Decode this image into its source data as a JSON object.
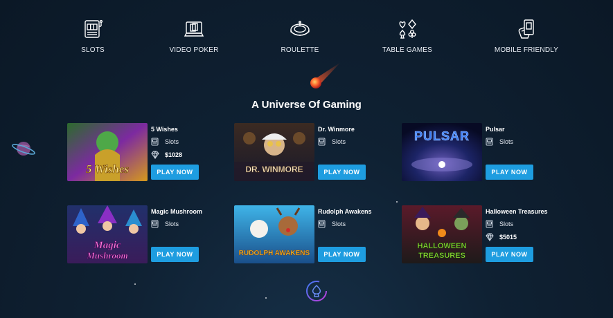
{
  "categories": [
    {
      "label": "SLOTS",
      "icon": "slot-machine-icon"
    },
    {
      "label": "VIDEO POKER",
      "icon": "video-poker-icon"
    },
    {
      "label": "ROULETTE",
      "icon": "roulette-icon"
    },
    {
      "label": "TABLE GAMES",
      "icon": "card-suits-icon"
    },
    {
      "label": "MOBILE FRIENDLY",
      "icon": "mobile-cards-icon"
    }
  ],
  "section": {
    "heading": "A Universe Of Gaming"
  },
  "games": [
    {
      "title": "5 Wishes",
      "type": "Slots",
      "jackpot": "$1028",
      "button": "PLAY NOW",
      "thumb_text": "5 Wishes"
    },
    {
      "title": "Dr. Winmore",
      "type": "Slots",
      "button": "PLAY NOW",
      "thumb_text": "DR. WINMORE"
    },
    {
      "title": "Pulsar",
      "type": "Slots",
      "button": "PLAY NOW",
      "thumb_text": "PULSAR"
    },
    {
      "title": "Magic Mushroom",
      "type": "Slots",
      "button": "PLAY NOW",
      "thumb_text": "Magic Mushroom"
    },
    {
      "title": "Rudolph Awakens",
      "type": "Slots",
      "button": "PLAY NOW",
      "thumb_text": "RUDOLPH AWAKENS"
    },
    {
      "title": "Halloween Treasures",
      "type": "Slots",
      "jackpot": "$5015",
      "button": "PLAY NOW",
      "thumb_text": "HALLOWEEN TREASURES"
    }
  ],
  "colors": {
    "button": "#1e9de0",
    "background": "#0f2133"
  }
}
